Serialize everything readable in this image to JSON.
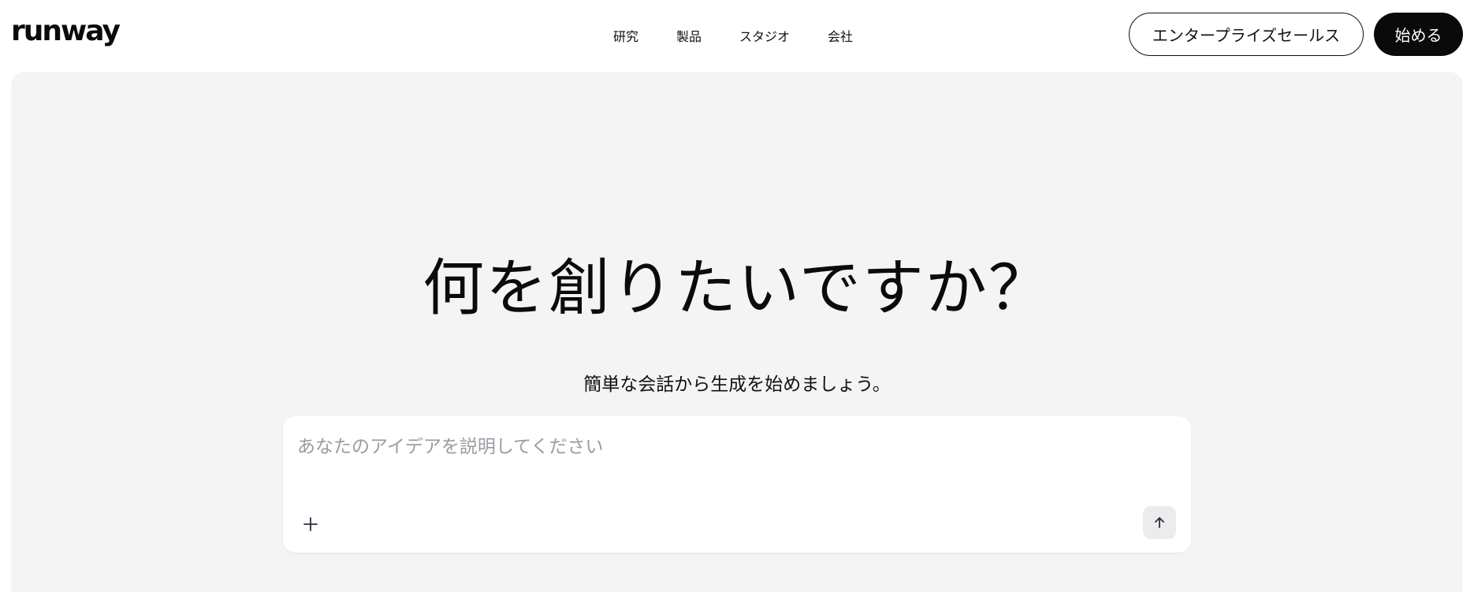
{
  "header": {
    "logo": "runway",
    "nav": [
      {
        "label": "研究"
      },
      {
        "label": "製品"
      },
      {
        "label": "スタジオ"
      },
      {
        "label": "会社"
      }
    ],
    "enterprise_label": "エンタープライズセールス",
    "start_label": "始める"
  },
  "hero": {
    "title": "何を創りたいですか？",
    "subtitle": "簡単な会話から生成を始めましょう。"
  },
  "prompt": {
    "placeholder": "あなたのアイデアを説明してください",
    "value": ""
  },
  "icons": {
    "attach": "plus-icon",
    "submit": "arrow-up-icon"
  },
  "colors": {
    "panel_bg": "#f4f4f4",
    "primary_button_bg": "#0a0a0a",
    "placeholder": "#9a9ca4",
    "submit_button_bg": "#ececef"
  }
}
